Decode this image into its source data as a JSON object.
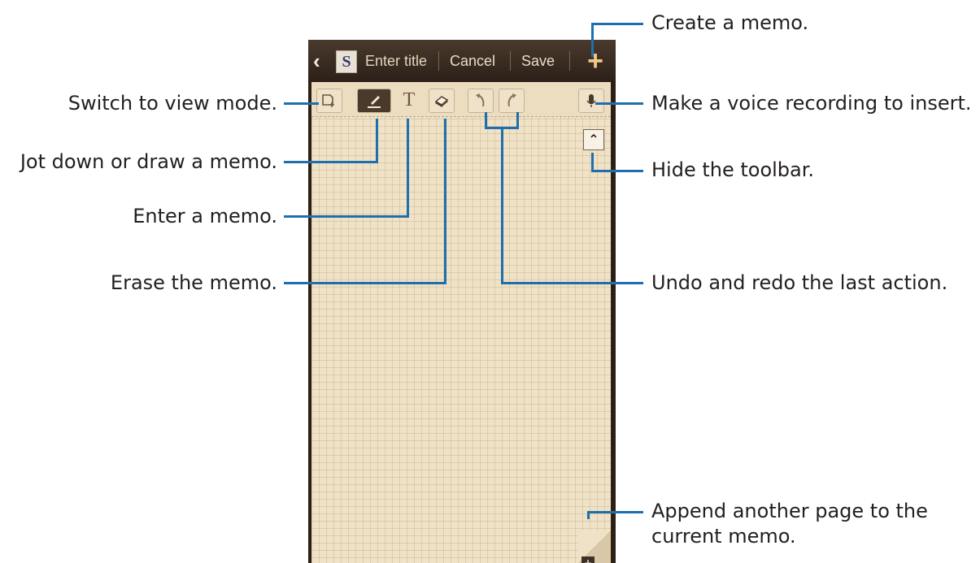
{
  "topbar": {
    "back_icon": "chevron-left-icon",
    "logo_letter": "S",
    "title_placeholder": "Enter title",
    "cancel_label": "Cancel",
    "save_label": "Save",
    "add_icon": "plus-icon"
  },
  "toolbar": {
    "view_mode_icon": "view-mode-icon",
    "pen_icon": "pen-icon",
    "text_icon": "T",
    "eraser_icon": "eraser-icon",
    "undo_icon": "undo-icon",
    "redo_icon": "redo-icon",
    "mic_icon": "microphone-icon",
    "collapse_icon": "chevron-up-icon",
    "add_page_icon": "add-page-icon"
  },
  "callouts": {
    "create_memo": "Create a memo.",
    "view_mode": "Switch to view mode.",
    "voice_recording": "Make a voice recording to insert.",
    "draw_memo": "Jot down or draw a memo.",
    "hide_toolbar": "Hide the toolbar.",
    "enter_memo": "Enter a memo.",
    "erase_memo": "Erase the memo.",
    "undo_redo": "Undo and redo the last action.",
    "append_page_line1": "Append another page to the",
    "append_page_line2": "current memo."
  },
  "colors": {
    "callout_line": "#1f6fae",
    "paper": "#efe2c6",
    "topbar": "#2b2018",
    "accent_plus": "#f0c78d"
  }
}
